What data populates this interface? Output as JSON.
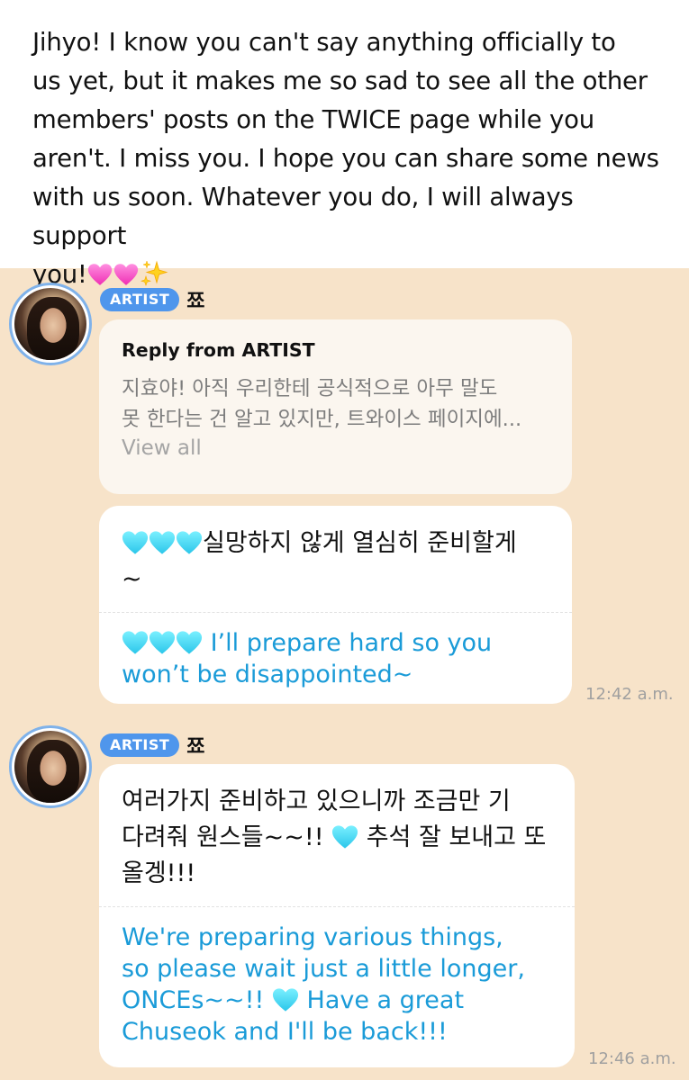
{
  "fan_post": {
    "text_lines": [
      "Jihyo! I know you can't say anything officially to",
      "us yet, but it makes me so sad to see all the other",
      "members' posts on the TWICE page while you",
      "aren't. I miss you. I hope you can share some news",
      "with us soon. Whatever you do, I will always support",
      "you!"
    ],
    "trailing_emoji": [
      "pink-heart-icon",
      "pink-heart-icon",
      "sparkles-icon"
    ]
  },
  "messages": [
    {
      "badge": "ARTIST",
      "name": "쬬",
      "reply": {
        "title": "Reply from ARTIST",
        "body_lines": [
          "지효야! 아직 우리한테 공식적으로 아무 말도",
          "못 한다는 건 알고 있지만, 트와이스 페이지에..."
        ],
        "view_all": "View all"
      },
      "korean_lines": [
        "실망하지 않게 열심히 준비할게",
        "~"
      ],
      "english_lines": [
        "I’ll prepare hard so you",
        "won’t be disappointed~"
      ],
      "time": "12:42 a.m."
    },
    {
      "badge": "ARTIST",
      "name": "쬬",
      "korean_lines": [
        " 여러가지 준비하고 있으니까 조금만 기",
        "다려줘 원스들~~!!",
        "추석 잘 보내고 또",
        "올겡!!!"
      ],
      "english_lines": [
        "We're preparing various things,",
        "so please wait just a little longer,",
        "ONCEs~~!!",
        "Have a great",
        "Chuseok and I'll be back!!!"
      ],
      "time": "12:46 a.m."
    }
  ],
  "colors": {
    "chat_background": "#f7e3c9",
    "artist_badge": "#4f96ec",
    "translation_text": "#1a9bd8",
    "avatar_ring": "#7fb2ea"
  }
}
